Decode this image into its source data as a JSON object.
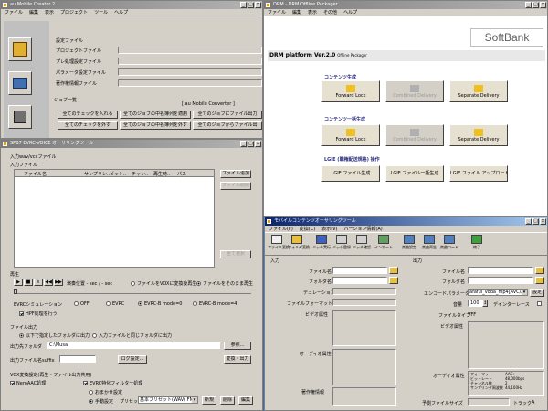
{
  "w1": {
    "title": "au Mobile Creator 2",
    "menu": [
      "ファイル",
      "編集",
      "表示",
      "プロジェクト",
      "ツール",
      "ヘルプ"
    ],
    "labels": [
      "設定ファイル",
      "プロジェクトファイル",
      "プレ処理設定ファイル",
      "パラメータ設定ファイル",
      "著作権情報ファイル"
    ],
    "job_title": "ジョブ一覧",
    "job_right": "[ au Mobile Converter ]",
    "btns": [
      "全てのチェックを入れる",
      "全てのジョブの中名簿列を適用",
      "全てのジョブにファイル出力",
      "全てのチェックを外す",
      "全てのジョブの中名簿列を外す",
      "全てのジョブからファイル出"
    ]
  },
  "w2": {
    "title": "DRM - DRM Offline Packager",
    "menu": [
      "ファイル",
      "編集",
      "表示",
      "その他",
      "ヘルプ"
    ],
    "logo": "SoftBank",
    "heading": "DRM platform Ver.2.0",
    "heading_sub": "Offline Packager",
    "sec1": "コンテンツ生成",
    "sec2": "コンテンツ一括生成",
    "sec3": "LGIE (職権配送規格) 操作",
    "cards": [
      "Forward Lock",
      "Combined Delivery",
      "Separate Delivery"
    ],
    "lg": [
      "LGIE ファイル生成",
      "LGIE ファイル一括生成",
      "LGIE ファイル アップロード"
    ]
  },
  "w3": {
    "title": "SPB7 EVRC-VOICE オーサリングツール",
    "section": "入力wav/vcxファイル",
    "sub": "入力ファイル",
    "cols": [
      "ファイル名",
      "サンプリン..",
      "ビット..",
      "チャン..",
      "再生時..",
      "パス"
    ],
    "b_add": "ファイル追加",
    "b_del": "ファイル削除",
    "b_all": "全て選択",
    "play": "再生",
    "time": "演奏位置  - sec / - sec",
    "r_evrc": "ファイルをVOXに変換後再生",
    "r_raw": "ファイルをそのまま再生",
    "sim": "EVRCシミュレーション",
    "r_off": "OFF",
    "r_evrc2": "EVRC",
    "r_m0": "EVRC-B mode=0",
    "r_m4": "EVRC-B mode=4",
    "hpf": "HPF処理を行う",
    "out": "ファイル出力",
    "o1": "以下で指定したフォルダに出力",
    "o2": "入力ファイルと同じフォルダに出力",
    "out_folder": "出力先フォルダ",
    "out_path": "C:\\Musa",
    "ref": "参照...",
    "suffix": "出力ファイル名suffix",
    "log": "ログ設定...",
    "conv": "変換・出力",
    "vox": "VOX変換設定(再生・ファイル出力共用)",
    "nero": "NeroAAC処理",
    "ev_filter": "EVRC特化フィルター処理",
    "auto": "おまかせ設定",
    "manual": "手動設定",
    "preset": "プリセット",
    "preset_val": "基本プリセット(WAV) FN",
    "new": "新規",
    "delete": "削除",
    "edit": "編集"
  },
  "w4": {
    "title": "モバイルコンテンツオーサリングツール",
    "menu": [
      "ファイル(F)",
      "変換(C)",
      "表示(V)",
      "バージョン情報(A)"
    ],
    "tools": [
      "ファイル変換",
      "フォルダ変換",
      "バッチ実行",
      "バッチ登録",
      "バッチ確認",
      "インポート",
      "楽曲設定",
      "楽曲再生",
      "楽曲ロード",
      "終了"
    ],
    "in": "入力",
    "outg": "出力",
    "fname": "ファイル名",
    "folder": "フォルダ名",
    "dur": "デュレーション",
    "fmt": "ファイルフォーマット",
    "vattr": "ビデオ属性",
    "aattr": "オーディオ属性",
    "copyright": "著作権情報",
    "oname": "ファイル名",
    "ofolder": "フォルダ名",
    "enc": "エンコードパラメータ",
    "enc_val": "afaful_voda_mp4[AVC/AAC]",
    "cfg": "設定",
    "vol": "音量",
    "vol_val": "100",
    "tinder": "デインターレース",
    "ftype": "ファイルタイプ",
    "ftype_val": "VFF",
    "ovattr": "ビデオ属性",
    "oaattr": "オーディオ属性",
    "a_keys": [
      "フォーマット",
      "ビットレート",
      "チャンネル数",
      "サンプリング周波数"
    ],
    "a_vals": [
      "AAC+",
      "48,000bps",
      "2",
      "44,100Hz"
    ],
    "size": "予測ファイルサイズ",
    "track": "トラック",
    "track_val": "A"
  }
}
